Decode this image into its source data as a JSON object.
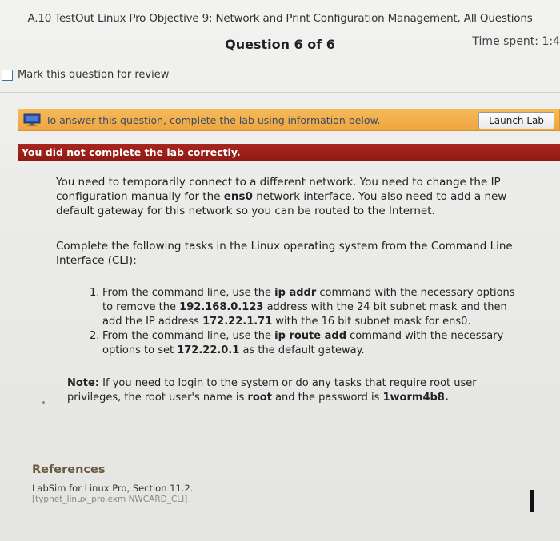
{
  "header": {
    "course_title": "A.10 TestOut Linux Pro Objective 9: Network and Print Configuration Management, All Questions",
    "question_number": "Question 6 of 6",
    "time_spent": "Time spent: 1:4"
  },
  "review": {
    "label": "Mark this question for review",
    "checked": false
  },
  "lab_banner": {
    "instruction": "To answer this question, complete the lab using information below.",
    "launch_label": "Launch Lab",
    "icon": "monitor-icon",
    "color": "#eea640"
  },
  "status": {
    "message": "You did not complete the lab correctly.",
    "color": "#9a1f18"
  },
  "body": {
    "p1_a": "You need to temporarily connect to a different network. You need to change the IP configuration manually for the ",
    "p1_b": "ens0",
    "p1_c": " network interface. You also need to add a new default gateway for this network so you can be routed to the Internet.",
    "p2": "Complete the following tasks in the Linux operating system from the Command Line Interface (CLI):",
    "task1_num": "1.",
    "task1_a": "From the command line, use the ",
    "task1_b": "ip addr",
    "task1_c": " command with the necessary options to remove the ",
    "task1_d": "192.168.0.123",
    "task1_e": " address with the 24 bit subnet mask and then add the IP address ",
    "task1_f": "172.22.1.71",
    "task1_g": " with the 16 bit subnet mask for ens0.",
    "task2_num": "2.",
    "task2_a": "From the command line, use the ",
    "task2_b": "ip route add",
    "task2_c": " command with the necessary options to set ",
    "task2_d": "172.22.0.1",
    "task2_e": " as the default gateway.",
    "note_label": "Note:",
    "note_a": " If you need to login to the system or do any tasks that require root user privileges, the root user's name is ",
    "note_b": "root",
    "note_c": " and the password is ",
    "note_d": "1worm4b8."
  },
  "references": {
    "heading": "References",
    "line1": "LabSim for Linux Pro, Section 11.2.",
    "line2": "[typnet_linux_pro.exm NWCARD_CLI]"
  }
}
